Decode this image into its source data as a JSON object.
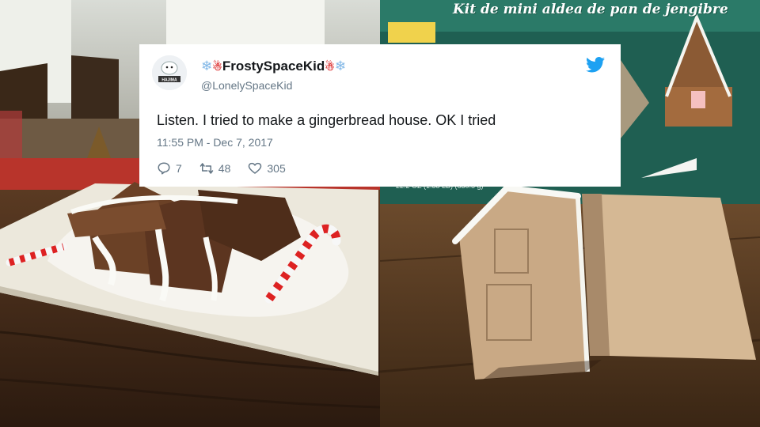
{
  "tweet": {
    "display_name": "FrostySpaceKid",
    "handle": "@LonelySpaceKid",
    "avatar_badge": "HAJIMA",
    "text": "Listen. I tried to make a gingerbread house. OK I tried",
    "timestamp": "11:55 PM - Dec 7, 2017",
    "replies": "7",
    "retweets": "48",
    "likes": "305",
    "icons": [
      "twitter-bird-icon",
      "reply-icon",
      "retweet-icon",
      "heart-icon",
      "snowflake-icon",
      "snowman-icon"
    ],
    "brand_color": "#1da1f2"
  },
  "background": {
    "box_text": "Kit de mini aldea de pan de jengibre",
    "box_weight_text": "22.2 OZ (1.38 LB) (630.5 g)"
  }
}
